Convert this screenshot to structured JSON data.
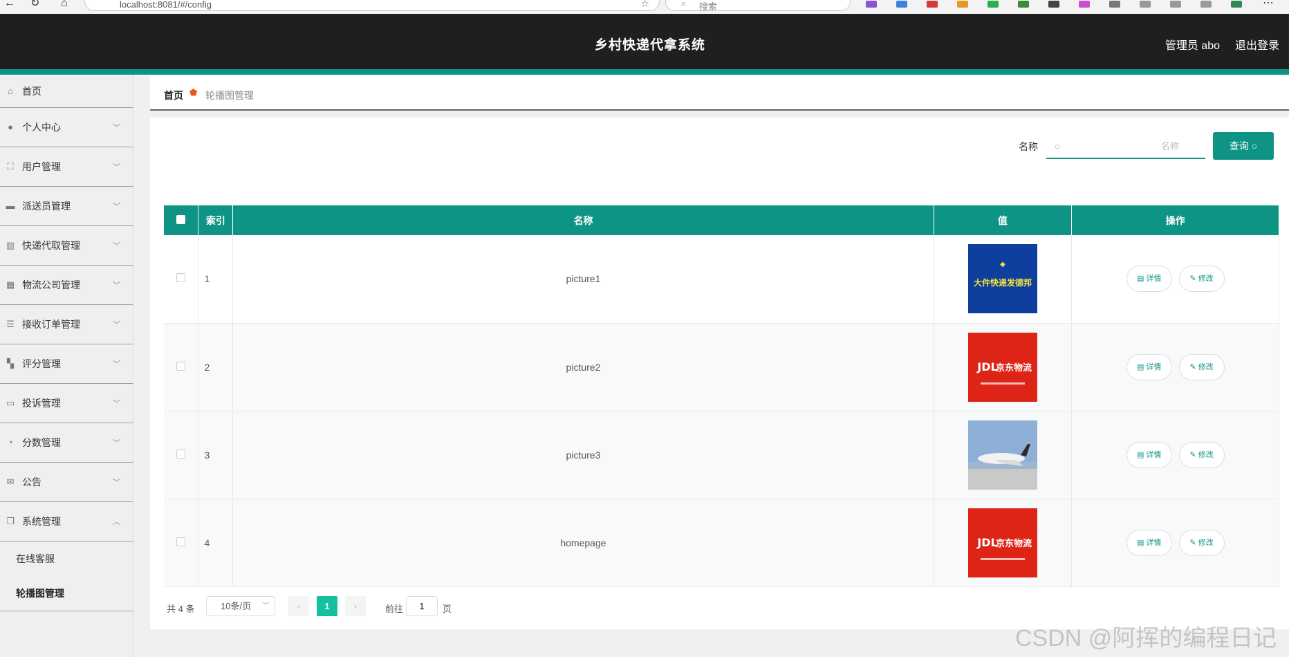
{
  "browser": {
    "url": "localhost:8081/#/config",
    "search_placeholder": "搜索"
  },
  "header": {
    "title": "乡村快递代拿系统",
    "user": "管理员 abo",
    "logout": "退出登录"
  },
  "sidebar": {
    "items": [
      {
        "label": "首页",
        "icon": "home-icon",
        "chevron": false
      },
      {
        "label": "个人中心",
        "icon": "user-icon",
        "chevron": true
      },
      {
        "label": "用户管理",
        "icon": "frame-icon",
        "chevron": true
      },
      {
        "label": "派送员管理",
        "icon": "briefcase-icon",
        "chevron": true
      },
      {
        "label": "快递代取管理",
        "icon": "library-icon",
        "chevron": true
      },
      {
        "label": "物流公司管理",
        "icon": "grid-icon",
        "chevron": true
      },
      {
        "label": "接收订单管理",
        "icon": "sliders-icon",
        "chevron": true
      },
      {
        "label": "评分管理",
        "icon": "apps-icon",
        "chevron": true
      },
      {
        "label": "投诉管理",
        "icon": "monitor-icon",
        "chevron": true
      },
      {
        "label": "分数管理",
        "icon": "gauge-icon",
        "chevron": true
      },
      {
        "label": "公告",
        "icon": "mailbox-icon",
        "chevron": true
      },
      {
        "label": "系统管理",
        "icon": "copy-icon",
        "chevron": true,
        "expanded": true
      }
    ],
    "submenu": [
      "在线客服",
      "轮播图管理"
    ]
  },
  "breadcrumb": {
    "home": "首页",
    "current": "轮播图管理"
  },
  "search": {
    "label": "名称",
    "placeholder": "名称",
    "button": "查询"
  },
  "table": {
    "headers": [
      "索引",
      "名称",
      "值",
      "操作"
    ],
    "rows": [
      {
        "index": "1",
        "name": "picture1",
        "thumb": {
          "bg": "#0f3f9e",
          "fg": "#f2e23a",
          "caption": "大件快递发德邦",
          "kind": "text"
        }
      },
      {
        "index": "2",
        "name": "picture2",
        "thumb": {
          "bg": "#dd2417",
          "fg": "#ffffff",
          "caption": "京东物流",
          "kind": "logo"
        }
      },
      {
        "index": "3",
        "name": "picture3",
        "thumb": {
          "bg": "#9fb6cf",
          "fg": "#ffffff",
          "caption": "",
          "kind": "plane"
        }
      },
      {
        "index": "4",
        "name": "homepage",
        "thumb": {
          "bg": "#dd2417",
          "fg": "#ffffff",
          "caption": "京东物流",
          "kind": "logo"
        }
      }
    ],
    "actions": {
      "detail": "详情",
      "edit": "修改"
    }
  },
  "pagination": {
    "total": "共 4 条",
    "page_size": "10条/页",
    "current_page": "1",
    "goto_label": "前往",
    "goto_value": "1",
    "page_unit": "页"
  },
  "watermark": "CSDN @阿挥的编程日记",
  "colors": {
    "accent": "#0e9484",
    "header_bg": "#1f1f1f",
    "active_page": "#13c0a0"
  }
}
